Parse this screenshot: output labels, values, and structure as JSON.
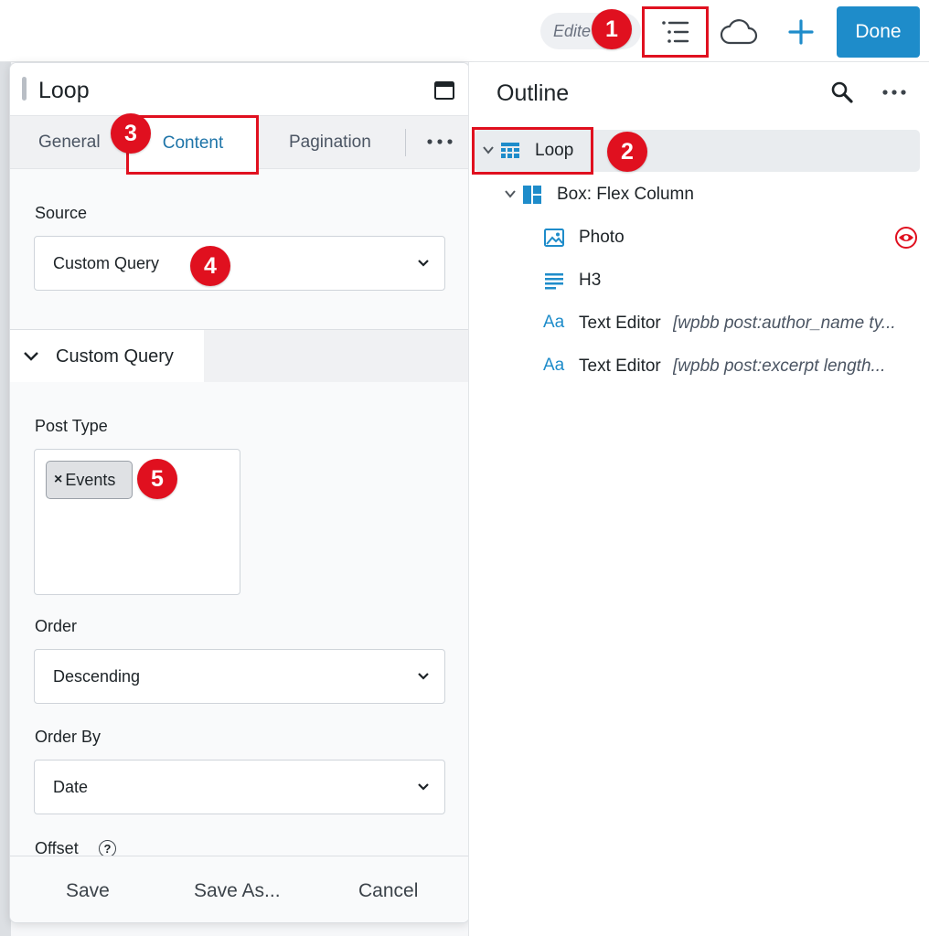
{
  "topbar": {
    "edited_label": "Edite",
    "done_label": "Done",
    "icons": {
      "outline": "outline-list-icon",
      "cloud": "cloud-icon",
      "add": "plus-icon"
    },
    "accent": "#1e8cca"
  },
  "annotations": [
    "1",
    "2",
    "3",
    "4",
    "5"
  ],
  "annotation_color": "#e0101f",
  "panel": {
    "title": "Loop",
    "tabs": [
      {
        "label": "General",
        "active": false
      },
      {
        "label": "Content",
        "active": true
      },
      {
        "label": "Pagination",
        "active": false
      }
    ],
    "source": {
      "label": "Source",
      "value": "Custom Query"
    },
    "section": {
      "title": "Custom Query"
    },
    "post_type": {
      "label": "Post Type",
      "tags": [
        "Events"
      ]
    },
    "order": {
      "label": "Order",
      "value": "Descending"
    },
    "order_by": {
      "label": "Order By",
      "value": "Date"
    },
    "offset": {
      "label": "Offset",
      "help_glyph": "?"
    },
    "footer": {
      "save": "Save",
      "save_as": "Save As...",
      "cancel": "Cancel"
    }
  },
  "outline": {
    "title": "Outline",
    "rows": [
      {
        "label": "Loop",
        "icon": "loop-grid-icon"
      },
      {
        "label": "Box: Flex Column",
        "icon": "box-layout-icon"
      },
      {
        "label": "Photo",
        "icon": "photo-icon"
      },
      {
        "label": "H3",
        "icon": "heading-icon"
      },
      {
        "label": "Text Editor",
        "icon_text": "Aa",
        "meta": "[wpbb post:author_name ty..."
      },
      {
        "label": "Text Editor",
        "icon_text": "Aa",
        "meta": "[wpbb post:excerpt length..."
      }
    ]
  }
}
